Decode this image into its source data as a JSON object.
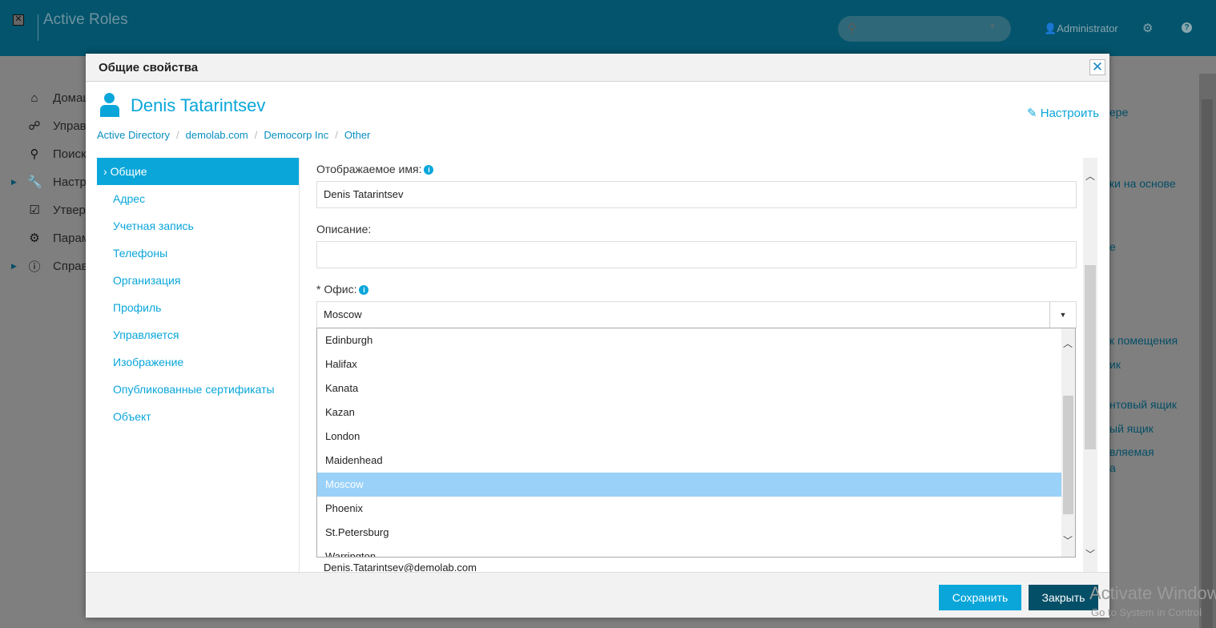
{
  "app": {
    "title": "Active Roles",
    "user": "Administrator",
    "icons": {
      "search": "search-icon",
      "settings": "gear-icon",
      "help": "help-icon"
    }
  },
  "background": {
    "nav": [
      "Домаш",
      "Управ",
      "Поиск",
      "Настр",
      "Утвер",
      "Парам",
      "Справ"
    ],
    "right_texts": [
      "ере",
      "ки на основе",
      "е",
      "к помещения",
      "ик",
      "нтовый ящик",
      "ый ящик",
      "вляемая",
      "а"
    ],
    "watermark": "Activate Windows",
    "watermark_sub": "Go to System in Control"
  },
  "dialog": {
    "title": "Общие свойства",
    "person_name": "Denis Tatarintsev",
    "customize": "Настроить",
    "breadcrumb": [
      "Active Directory",
      "demolab.com",
      "Democorp Inc",
      "Other"
    ],
    "nav": [
      "Общие",
      "Адрес",
      "Учетная запись",
      "Телефоны",
      "Организация",
      "Профиль",
      "Управляется",
      "Изображение",
      "Опубликованные сертификаты",
      "Объект"
    ],
    "active_nav": "Общие",
    "form": {
      "display_name_label": "Отображаемое имя:",
      "display_name_value": "Denis Tatarintsev",
      "description_label": "Описание:",
      "description_value": "",
      "office_label": "* Офис:",
      "office_value": "Moscow",
      "office_options": [
        "Edinburgh",
        "Halifax",
        "Kanata",
        "Kazan",
        "London",
        "Maidenhead",
        "Moscow",
        "Phoenix",
        "St.Petersburg",
        "Warrington"
      ],
      "email_value": "Denis.Tatarintsev@demolab.com"
    },
    "buttons": {
      "save": "Сохранить",
      "close": "Закрыть"
    },
    "colors": {
      "accent": "#0aa6da",
      "dark": "#034f67",
      "selected_option": "#99d1f9"
    }
  }
}
